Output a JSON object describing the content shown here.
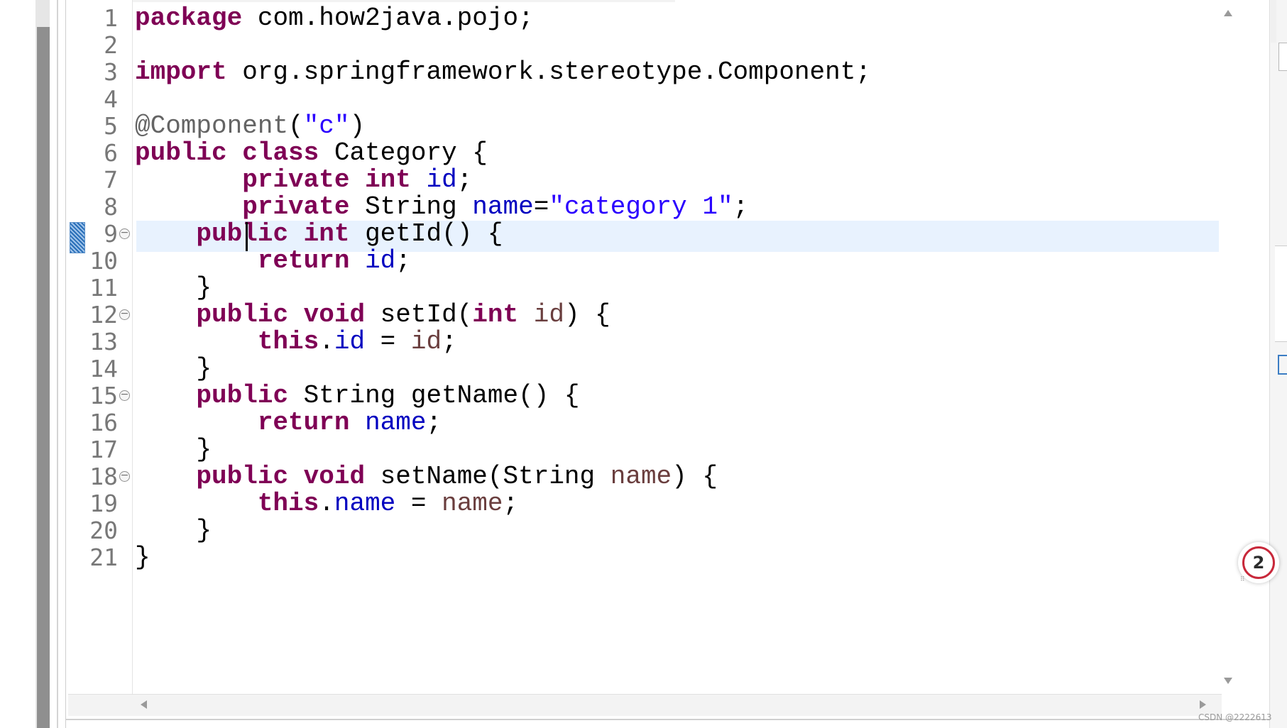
{
  "editor": {
    "line_numbers": [
      "1",
      "2",
      "3",
      "4",
      "5",
      "6",
      "7",
      "8",
      "9",
      "10",
      "11",
      "12",
      "13",
      "14",
      "15",
      "16",
      "17",
      "18",
      "19",
      "20",
      "21"
    ],
    "current_line": 8,
    "lines": [
      [
        {
          "t": "package",
          "c": "kw"
        },
        {
          "t": " com.how2java.pojo;",
          "c": "pl"
        }
      ],
      [],
      [
        {
          "t": "import",
          "c": "kw"
        },
        {
          "t": " org.springframework.stereotype.Component;",
          "c": "pl"
        }
      ],
      [],
      [
        {
          "t": "@Component",
          "c": "ann"
        },
        {
          "t": "(",
          "c": "pl"
        },
        {
          "t": "\"c\"",
          "c": "str"
        },
        {
          "t": ")",
          "c": "pl"
        }
      ],
      [
        {
          "t": "public",
          "c": "kw"
        },
        {
          "t": " ",
          "c": "pl"
        },
        {
          "t": "class",
          "c": "kw"
        },
        {
          "t": " Category {",
          "c": "pl"
        }
      ],
      [
        {
          "t": "       ",
          "c": "pl"
        },
        {
          "t": "private",
          "c": "kw"
        },
        {
          "t": " ",
          "c": "pl"
        },
        {
          "t": "int",
          "c": "kw"
        },
        {
          "t": " ",
          "c": "pl"
        },
        {
          "t": "id",
          "c": "fld"
        },
        {
          "t": ";",
          "c": "pl"
        }
      ],
      [
        {
          "t": "       ",
          "c": "pl"
        },
        {
          "t": "private",
          "c": "kw"
        },
        {
          "t": " String ",
          "c": "pl"
        },
        {
          "t": "name",
          "c": "fld"
        },
        {
          "t": "=",
          "c": "pl"
        },
        {
          "t": "\"category 1\"",
          "c": "str"
        },
        {
          "t": ";",
          "c": "pl"
        }
      ],
      [
        {
          "t": "    ",
          "c": "pl"
        },
        {
          "t": "public",
          "c": "kw"
        },
        {
          "t": " ",
          "c": "pl"
        },
        {
          "t": "int",
          "c": "kw"
        },
        {
          "t": " getId() {",
          "c": "pl"
        }
      ],
      [
        {
          "t": "        ",
          "c": "pl"
        },
        {
          "t": "return",
          "c": "kw"
        },
        {
          "t": " ",
          "c": "pl"
        },
        {
          "t": "id",
          "c": "fld"
        },
        {
          "t": ";",
          "c": "pl"
        }
      ],
      [
        {
          "t": "    }",
          "c": "pl"
        }
      ],
      [
        {
          "t": "    ",
          "c": "pl"
        },
        {
          "t": "public",
          "c": "kw"
        },
        {
          "t": " ",
          "c": "pl"
        },
        {
          "t": "void",
          "c": "kw"
        },
        {
          "t": " setId(",
          "c": "pl"
        },
        {
          "t": "int",
          "c": "kw"
        },
        {
          "t": " ",
          "c": "pl"
        },
        {
          "t": "id",
          "c": "var"
        },
        {
          "t": ") {",
          "c": "pl"
        }
      ],
      [
        {
          "t": "        ",
          "c": "pl"
        },
        {
          "t": "this",
          "c": "kw"
        },
        {
          "t": ".",
          "c": "pl"
        },
        {
          "t": "id",
          "c": "fld"
        },
        {
          "t": " = ",
          "c": "pl"
        },
        {
          "t": "id",
          "c": "var"
        },
        {
          "t": ";",
          "c": "pl"
        }
      ],
      [
        {
          "t": "    }",
          "c": "pl"
        }
      ],
      [
        {
          "t": "    ",
          "c": "pl"
        },
        {
          "t": "public",
          "c": "kw"
        },
        {
          "t": " String getName() {",
          "c": "pl"
        }
      ],
      [
        {
          "t": "        ",
          "c": "pl"
        },
        {
          "t": "return",
          "c": "kw"
        },
        {
          "t": " ",
          "c": "pl"
        },
        {
          "t": "name",
          "c": "fld"
        },
        {
          "t": ";",
          "c": "pl"
        }
      ],
      [
        {
          "t": "    }",
          "c": "pl"
        }
      ],
      [
        {
          "t": "    ",
          "c": "pl"
        },
        {
          "t": "public",
          "c": "kw"
        },
        {
          "t": " ",
          "c": "pl"
        },
        {
          "t": "void",
          "c": "kw"
        },
        {
          "t": " setName(String ",
          "c": "pl"
        },
        {
          "t": "name",
          "c": "var"
        },
        {
          "t": ") {",
          "c": "pl"
        }
      ],
      [
        {
          "t": "        ",
          "c": "pl"
        },
        {
          "t": "this",
          "c": "kw"
        },
        {
          "t": ".",
          "c": "pl"
        },
        {
          "t": "name",
          "c": "fld"
        },
        {
          "t": " = ",
          "c": "pl"
        },
        {
          "t": "name",
          "c": "var"
        },
        {
          "t": ";",
          "c": "pl"
        }
      ],
      [
        {
          "t": "    }",
          "c": "pl"
        }
      ],
      [
        {
          "t": "}",
          "c": "pl"
        }
      ]
    ],
    "fold_lines": [
      9,
      12,
      15,
      18
    ]
  },
  "colors": {
    "keyword": "#7f0055",
    "field": "#0000c0",
    "string": "#2a00ff",
    "annotation": "#646464",
    "local_variable": "#6a3e3e",
    "current_line_bg": "#e8f2fe",
    "badge_ring": "#c8283a"
  },
  "badge": {
    "count": "2"
  },
  "watermark": "CSDN @2222613"
}
